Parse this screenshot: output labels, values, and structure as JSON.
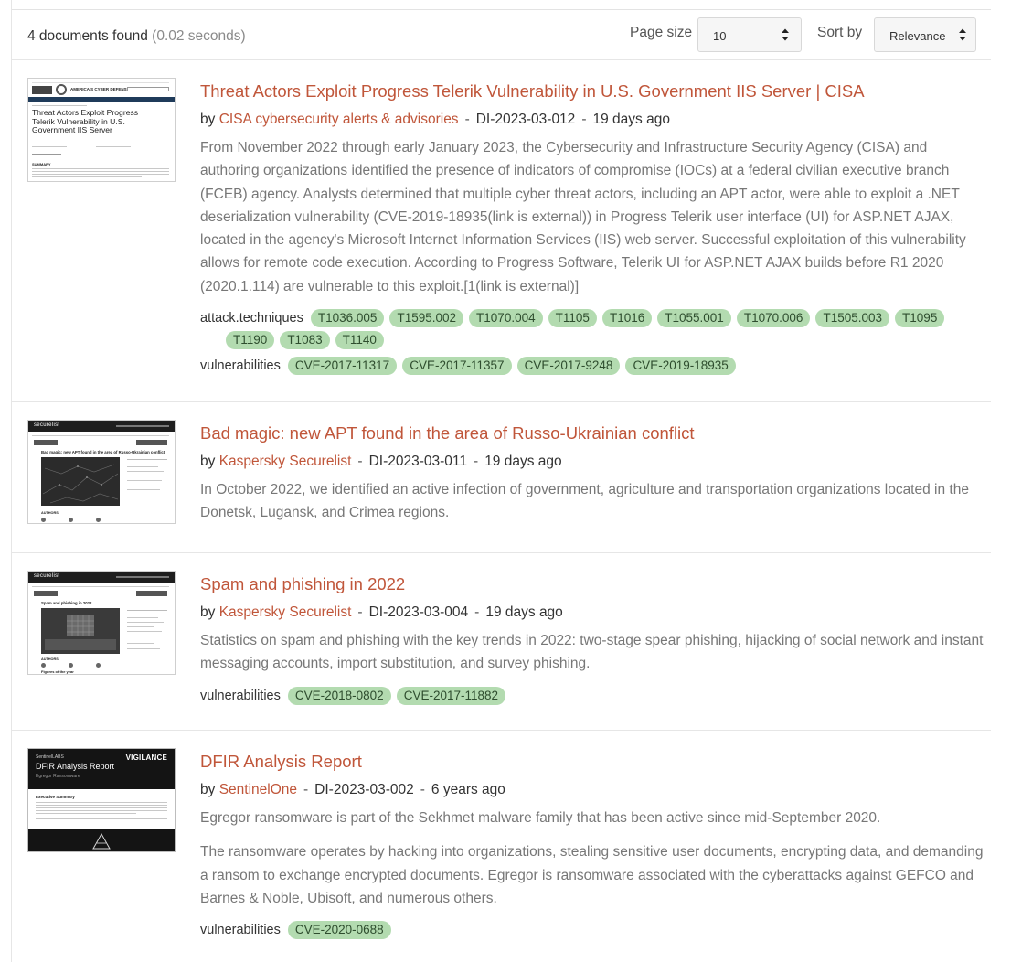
{
  "header": {
    "found_count": "4 documents found",
    "found_time": "(0.02 seconds)",
    "page_size_label": "Page size",
    "page_size_value": "10",
    "sort_label": "Sort by",
    "sort_value": "Relevance"
  },
  "results": [
    {
      "title": "Threat Actors Exploit Progress Telerik Vulnerability in U.S. Government IIS Server | CISA",
      "by": "by",
      "source": "CISA cybersecurity alerts & advisories",
      "id": "DI-2023-03-012",
      "age": "19 days ago",
      "desc": [
        "From November 2022 through early January 2023, the Cybersecurity and Infrastructure Security Agency (CISA) and authoring organizations identified the presence of indicators of compromise (IOCs) at a federal civilian executive branch (FCEB) agency. Analysts determined that multiple cyber threat actors, including an APT actor, were able to exploit a .NET deserialization vulnerability (CVE-2019-18935(link is external)) in Progress Telerik user interface (UI) for ASP.NET AJAX, located in the agency's Microsoft Internet Information Services (IIS) web server. Successful exploitation of this vulnerability allows for remote code execution. According to Progress Software, Telerik UI for ASP.NET AJAX builds before R1 2020 (2020.1.114) are vulnerable to this exploit.[1(link is external)]"
      ],
      "techniques_label": "attack.techniques",
      "techniques": [
        "T1036.005",
        "T1595.002",
        "T1070.004",
        "T1105",
        "T1016",
        "T1055.001",
        "T1070.006",
        "T1505.003",
        "T1095",
        "T1190",
        "T1083",
        "T1140"
      ],
      "vuln_label": "vulnerabilities",
      "vulnerabilities": [
        "CVE-2017-11317",
        "CVE-2017-11357",
        "CVE-2017-9248",
        "CVE-2019-18935"
      ],
      "thumb": {
        "banner": "AMERICA'S CYBER DEFENSE AGENCY",
        "headline": "Threat Actors Exploit Progress Telerik Vulnerability in U.S. Government IIS Server",
        "summary": "SUMMARY"
      }
    },
    {
      "title": "Bad magic: new APT found in the area of Russo-Ukrainian conflict",
      "by": "by",
      "source": "Kaspersky Securelist",
      "id": "DI-2023-03-011",
      "age": "19 days ago",
      "desc": [
        "In October 2022, we identified an active infection of government, agriculture and transportation organizations located in the Donetsk, Lugansk, and Crimea regions."
      ],
      "thumb": {
        "logo": "securelist",
        "headline": "Bad magic: new APT found in the area of Russo-Ukrainian conflict",
        "section": "AUTHORS"
      }
    },
    {
      "title": "Spam and phishing in 2022",
      "by": "by",
      "source": "Kaspersky Securelist",
      "id": "DI-2023-03-004",
      "age": "19 days ago",
      "desc": [
        "Statistics on spam and phishing with the key trends in 2022: two-stage spear phishing, hijacking of social network and instant messaging accounts, import substitution, and survey phishing."
      ],
      "vuln_label": "vulnerabilities",
      "vulnerabilities": [
        "CVE-2018-0802",
        "CVE-2017-11882"
      ],
      "thumb": {
        "logo": "securelist",
        "headline": "Spam and phishing in 2022",
        "section": "AUTHORS",
        "footer": "Figures of the year"
      }
    },
    {
      "title": "DFIR Analysis Report",
      "by": "by",
      "source": "SentinelOne",
      "id": "DI-2023-03-002",
      "age": "6 years ago",
      "desc": [
        "Egregor ransomware is part of the Sekhmet malware family that has been active since mid-September 2020.",
        "The ransomware operates by hacking into organizations, stealing sensitive user documents, encrypting data, and demanding a ransom to exchange encrypted documents. Egregor is ransomware associated with the cyberattacks against GEFCO and Barnes & Noble, Ubisoft, and numerous others."
      ],
      "vuln_label": "vulnerabilities",
      "vulnerabilities": [
        "CVE-2020-0688"
      ],
      "thumb": {
        "brand": "SentinelLABS",
        "mark": "VIGILANCE",
        "headline": "DFIR Analysis Report",
        "sub": "Egregor Ransomware",
        "section": "Executive Summary"
      }
    }
  ],
  "colors": {
    "link": "#c0563a",
    "tag_bg": "#b3dbb0",
    "tag_text": "#2e4d2e",
    "muted_text": "#777777"
  }
}
